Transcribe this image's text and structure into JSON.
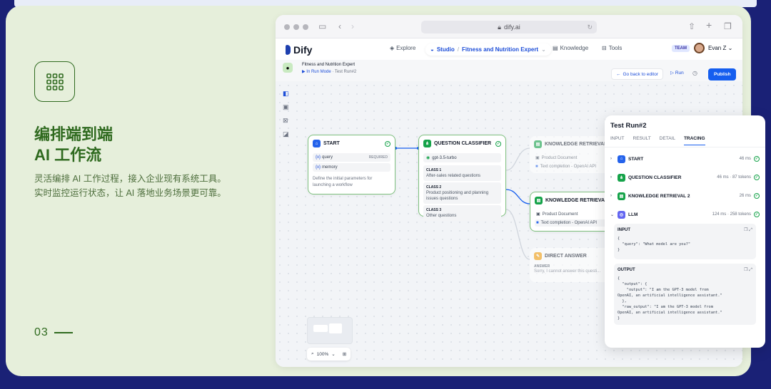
{
  "slide": {
    "headline_line1": "编排端到端",
    "headline_line2": "AI 工作流",
    "desc_line1": "灵活编排 AI 工作过程，接入企业现有系统工具。",
    "desc_line2": "实时监控运行状态，让 AI 落地业务场景更可靠。",
    "page_number": "03"
  },
  "browser": {
    "url": "dify.ai"
  },
  "nav": {
    "logo": "Dify",
    "explore": "Explore",
    "studio": "Studio",
    "app": "Fitness and Nutrition Expert",
    "knowledge": "Knowledge",
    "tools": "Tools",
    "team_badge": "TEAM",
    "user": "Evan Z"
  },
  "app": {
    "title": "Fitness and Nutrition Expert",
    "mode": "In Run Mode",
    "run": "Test Run#2",
    "back": "Go back to editor",
    "run_btn": "Run",
    "publish": "Publish"
  },
  "nodes": {
    "start": {
      "title": "START",
      "var1": "query",
      "var1_tag": "REQUIRED",
      "var2": "memory",
      "desc": "Define the initial parameters for launching a workflow"
    },
    "classifier": {
      "title": "QUESTION CLASSIFIER",
      "model": "gpt-3.5-turbo",
      "classes": [
        {
          "name": "CLASS 1",
          "text": "After-sales related questions"
        },
        {
          "name": "CLASS 2",
          "text": "Product positioning and planning issues questions"
        },
        {
          "name": "CLASS 3",
          "text": "Other questions"
        }
      ]
    },
    "kr1": {
      "title": "KNOWLEDGE RETRIEVAL",
      "item1": "Product Document",
      "item2": "Text completion - OpenAI API"
    },
    "kr2": {
      "title": "KNOWLEDGE RETRIEVA...",
      "item1": "Product Document",
      "item2": "Text completion - OpenAI API"
    },
    "direct": {
      "title": "DIRECT ANSWER",
      "label": "ANSWER",
      "text": "Sorry, I cannot answer this questi..."
    }
  },
  "zoom": "100%",
  "tracing": {
    "title": "Test Run#2",
    "tabs": [
      "INPUT",
      "RESULT",
      "DETAIL",
      "TRACING"
    ],
    "active_tab": "TRACING",
    "rows": [
      {
        "name": "START",
        "meta": "46 ms"
      },
      {
        "name": "QUESTION CLASSIFIER",
        "meta": "46 ms · 87 tokens"
      },
      {
        "name": "KNOWLEDGE RETRIEVAL 2",
        "meta": "26 ms"
      },
      {
        "name": "LLM",
        "meta": "124 ms · 258 tokens"
      }
    ],
    "input_label": "INPUT",
    "input_code": "{\n  \"query\": \"What model are you?\"\n}",
    "output_label": "OUTPUT",
    "output_code": "{\n  \"output\": {\n    \"output\": \"I am the GPT-3 model from\nOpenAI, an artificial intelligence assistant.\"\n  },\n  \"raw_output\": \"I am the GPT-3 model from\nOpenAI, an artificial intelligence assistant.\"\n}"
  },
  "colors": {
    "accent": "#155eef",
    "slide_green": "#2f6a1f",
    "bg_navy": "#1a2176",
    "card": "#e6efdb"
  }
}
